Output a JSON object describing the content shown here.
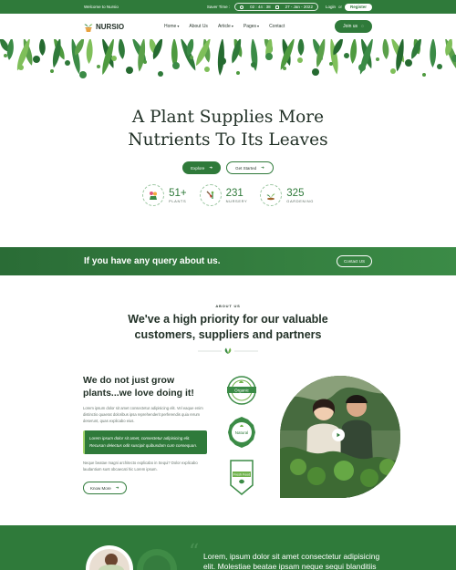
{
  "topbar": {
    "welcome": "Welcome to Nursio",
    "saver_label": "Saver Time :",
    "timer": "02 : 44 : 38",
    "date": "27 - Jan - 2022",
    "login": "Login",
    "or": "or",
    "register": "Register"
  },
  "nav": {
    "logo_text": "NURSIO",
    "items": [
      {
        "label": "Home",
        "dropdown": true
      },
      {
        "label": "About Us",
        "dropdown": false
      },
      {
        "label": "Article",
        "dropdown": true
      },
      {
        "label": "Pages",
        "dropdown": true
      },
      {
        "label": "Contact",
        "dropdown": false
      }
    ],
    "join": "Join us"
  },
  "hero": {
    "title_line1": "A Plant Supplies More",
    "title_line2": "Nutrients To Its Leaves",
    "explore": "Explore",
    "get_started": "Get Started",
    "stats": [
      {
        "value": "51+",
        "label": "PLANTS",
        "icon": "flower-icon"
      },
      {
        "value": "231",
        "label": "NURSERY",
        "icon": "shovel-icon"
      },
      {
        "value": "325",
        "label": "GARDENING",
        "icon": "sprout-icon"
      }
    ]
  },
  "query": {
    "text": "If you have any query about us.",
    "button": "Contact US"
  },
  "about": {
    "tag": "ABOUT US",
    "heading_line1": "We've a high priority for our valuable",
    "heading_line2": "customers, suppliers and partners",
    "sub_line1": "We do not just grow",
    "sub_line2": "plants...we love doing it!",
    "para1": "Lorem ipsum dolor sit amet consectetur adipisicing elit. Vel eaque enim distinctio quaerat doloribus ipsa reprehenderit perferendis quia rerum deserunt, quas explicabo eius.",
    "quote": "Lorem ipsum dolor sit amet, consectetur adipisicing elit. Recusan delectus odit suscipit quibusdam cum consequan.",
    "para2": "Neque beatae magni architecto explicabo in Sequi? Dolor explicabo laudantium sunt obcaecati hic Lorem ipsum.",
    "know_more": "Know More",
    "badges": [
      "Organic",
      "Natural",
      "Fresh Food"
    ]
  },
  "testimonial": {
    "text_line1": "Lorem, ipsum dolor sit amet consectetur adipisicing",
    "text_line2": "elit. Molestiae beatae ipsam neque sequi blanditiis"
  },
  "colors": {
    "brand_green": "#2f7a3a",
    "accent_lime": "#a4d46a"
  }
}
